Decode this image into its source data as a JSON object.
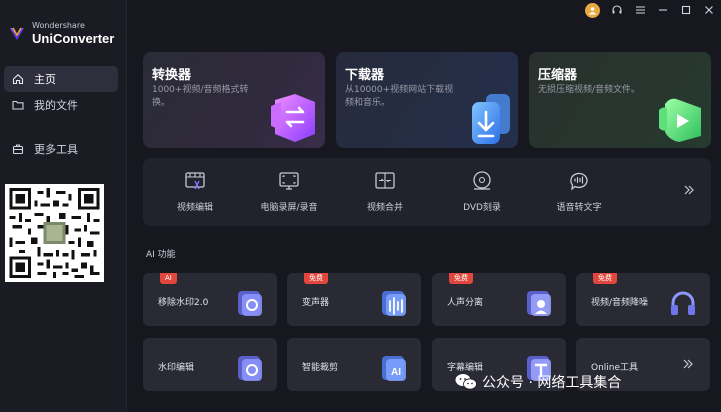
{
  "app": {
    "brand_sub": "Wondershare",
    "brand_main": "UniConverter"
  },
  "sidebar": {
    "items": [
      {
        "label": "主页",
        "icon": "home-icon",
        "active": true
      },
      {
        "label": "我的文件",
        "icon": "folder-icon",
        "active": false
      },
      {
        "label": "更多工具",
        "icon": "toolbox-icon",
        "active": false
      }
    ]
  },
  "topbar": {
    "icons": [
      "avatar-icon",
      "headset-icon",
      "menu-icon",
      "minimize-icon",
      "maximize-icon",
      "close-icon"
    ]
  },
  "feature_cards": [
    {
      "title": "转换器",
      "desc": "1000+视频/音频格式转换。"
    },
    {
      "title": "下载器",
      "desc": "从10000+视频网站下载视频和音乐。"
    },
    {
      "title": "压缩器",
      "desc": "无损压缩视频/音频文件。"
    }
  ],
  "tools": [
    {
      "label": "视频编辑",
      "icon": "video-edit-icon"
    },
    {
      "label": "电脑录屏/录音",
      "icon": "screen-record-icon"
    },
    {
      "label": "视频合并",
      "icon": "video-merge-icon"
    },
    {
      "label": "DVD刻录",
      "icon": "dvd-icon"
    },
    {
      "label": "语音转文字",
      "icon": "speech-to-text-icon"
    }
  ],
  "ai_section": {
    "title": "AI 功能"
  },
  "ai_cards": [
    {
      "label": "移除水印2.0",
      "badge": "AI"
    },
    {
      "label": "变声器",
      "badge": "免费"
    },
    {
      "label": "人声分离",
      "badge": "免费"
    },
    {
      "label": "视频/音频降噪",
      "badge": "免费"
    },
    {
      "label": "水印编辑",
      "badge": ""
    },
    {
      "label": "智能裁剪",
      "badge": ""
    },
    {
      "label": "字幕编辑",
      "badge": ""
    },
    {
      "label": "Online工具",
      "badge": ""
    }
  ],
  "watermark": {
    "text": "公众号 · 网络工具集合"
  },
  "colors": {
    "accent": "#7b5cff",
    "badge_red": "#e2463c",
    "background": "#17171f"
  }
}
